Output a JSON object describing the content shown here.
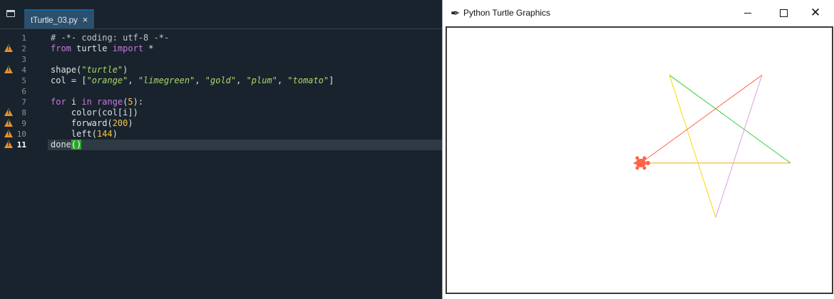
{
  "editor": {
    "tab": {
      "label": "tTurtle_03.py",
      "close": "×"
    },
    "gutter": [
      {
        "num": "1",
        "warn": false,
        "current": false
      },
      {
        "num": "2",
        "warn": true,
        "current": false
      },
      {
        "num": "3",
        "warn": false,
        "current": false
      },
      {
        "num": "4",
        "warn": true,
        "current": false
      },
      {
        "num": "5",
        "warn": false,
        "current": false
      },
      {
        "num": "6",
        "warn": false,
        "current": false
      },
      {
        "num": "7",
        "warn": false,
        "current": false
      },
      {
        "num": "8",
        "warn": true,
        "current": false
      },
      {
        "num": "9",
        "warn": true,
        "current": false
      },
      {
        "num": "10",
        "warn": true,
        "current": false
      },
      {
        "num": "11",
        "warn": true,
        "current": true
      }
    ],
    "lines": {
      "l1": {
        "comment": "# -*- coding: utf-8 -*-"
      },
      "l2": {
        "kw1": "from",
        "mid": " turtle ",
        "kw2": "import",
        "tail": " *"
      },
      "l4": {
        "pre": "shape(",
        "str": "\"turtle\"",
        "post": ")"
      },
      "l5": {
        "pre": "col = [",
        "s1": "\"orange\"",
        "s2": "\"limegreen\"",
        "s3": "\"gold\"",
        "s4": "\"plum\"",
        "s5": "\"tomato\"",
        "sep": ", ",
        "post": "]"
      },
      "l7": {
        "kw1": "for",
        "mid1": " i ",
        "kw2": "in",
        "kw3": " range",
        "pre": "(",
        "num": "5",
        "post": "):"
      },
      "l8": {
        "text": "    color(col[i])"
      },
      "l9": {
        "pre": "    forward(",
        "num": "200",
        "post": ")"
      },
      "l10": {
        "pre": "    left(",
        "num": "144",
        "post": ")"
      },
      "l11": {
        "pre": "done",
        "paren": "()"
      }
    }
  },
  "turtle_window": {
    "title": "Python Turtle Graphics",
    "controls": {
      "minimize": "",
      "maximize": "",
      "close": "✕"
    },
    "drawing": {
      "segments": [
        {
          "color": "#ffa500",
          "name": "orange"
        },
        {
          "color": "#32cd32",
          "name": "limegreen"
        },
        {
          "color": "#ffd700",
          "name": "gold"
        },
        {
          "color": "#dda0dd",
          "name": "plum"
        },
        {
          "color": "#ff6347",
          "name": "tomato"
        }
      ],
      "turtle_color": "#ff6347",
      "step": 200,
      "turn_deg": 144
    }
  }
}
